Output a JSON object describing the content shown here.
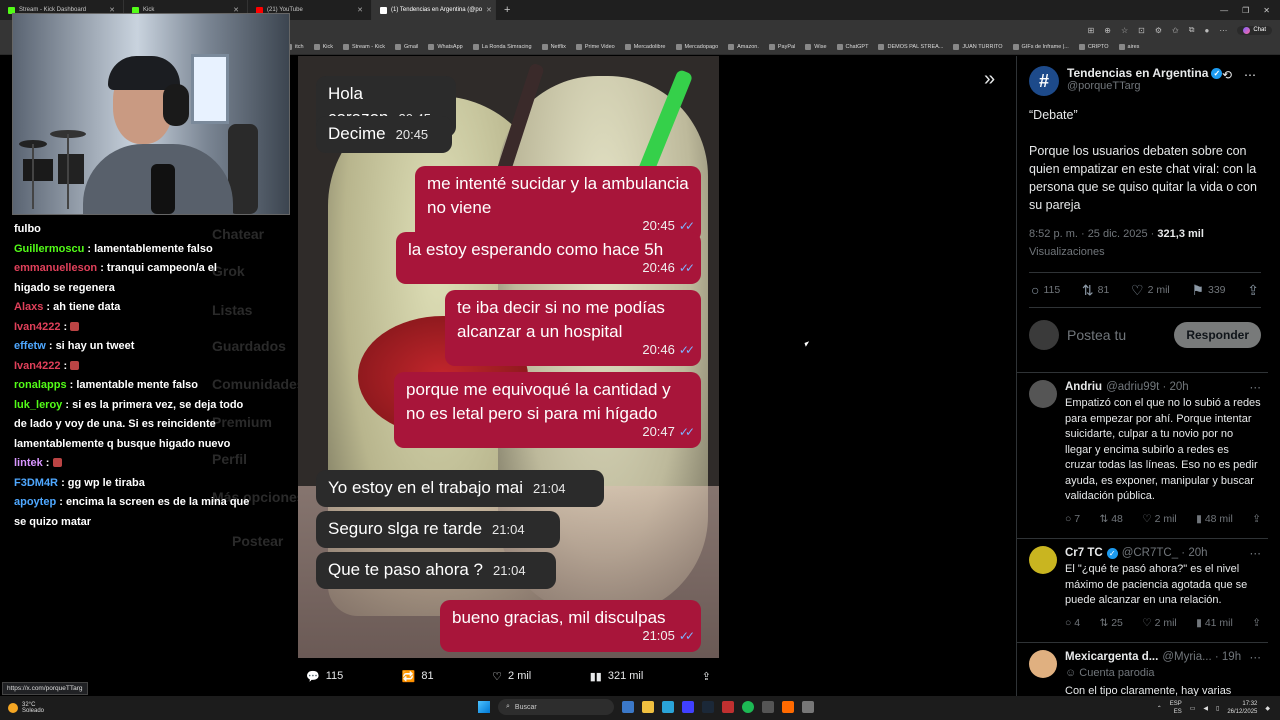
{
  "browser": {
    "tabs": [
      {
        "label": "Stream - Kick Dashboard",
        "active": false,
        "color": "#53fc18"
      },
      {
        "label": "Kick",
        "active": false,
        "color": "#53fc18"
      },
      {
        "label": "(21) YouTube",
        "active": false,
        "color": "#ff0000"
      },
      {
        "label": "(1) Tendencias en Argentina (@po",
        "active": true,
        "color": "#ffffff"
      }
    ],
    "new_tab": "+",
    "chat_label": "Chat",
    "bookmarks": [
      "itch",
      "Kick",
      "Stream - Kick",
      "Gmail",
      "WhatsApp",
      "La Ronda Simracing",
      "Netflix",
      "Prime Video",
      "Mercadolibre",
      "Mercadopago",
      "Amazon.",
      "PayPal",
      "Wise",
      "ChatGPT",
      "DEMOS PAL STREA...",
      "JUAN TURRITO",
      "GIFs de Inframe |...",
      "CRIPTO",
      "aires"
    ]
  },
  "chat": [
    {
      "user": "",
      "text": "fulbo",
      "color": "#ffffff"
    },
    {
      "user": "Guillermoscu",
      "text": "lamentablemente falso",
      "color": "#53fc18"
    },
    {
      "user": "emmanuelleson",
      "text": "tranqui campeon/a el higado se regenera",
      "color": "#e0405a"
    },
    {
      "user": "Alaxs",
      "text": "ah tiene data",
      "color": "#e0405a"
    },
    {
      "user": "Ivan4222",
      "text": "",
      "color": "#e0405a"
    },
    {
      "user": "effetw",
      "text": "si hay un tweet",
      "color": "#4fa8ff"
    },
    {
      "user": "Ivan4222",
      "text": "",
      "color": "#e0405a"
    },
    {
      "user": "ronalapps",
      "text": "lamentable mente falso",
      "color": "#53fc18"
    },
    {
      "user": "luk_leroy",
      "text": "si es la primera vez, se deja todo de lado y voy de una. Si es reincidente lamentablemente q busque higado nuevo",
      "color": "#53fc18"
    },
    {
      "user": "lintek",
      "text": "",
      "color": "#d896ff"
    },
    {
      "user": "F3DM4R",
      "text": "gg wp le tiraba",
      "color": "#4fa8ff"
    },
    {
      "user": "apoytep",
      "text": "encima la screen es de la mina que se quizo matar",
      "color": "#4fa8ff"
    }
  ],
  "ghost_menu": [
    "Chatear",
    "Grok",
    "Listas",
    "Guardados",
    "Comunidades",
    "Premium",
    "Perfil",
    "Más opciones",
    "Postear"
  ],
  "whatsapp": [
    {
      "dir": "in",
      "text": "Hola corazon",
      "time": "20:45"
    },
    {
      "dir": "in",
      "text": "Decime",
      "time": "20:45"
    },
    {
      "dir": "out",
      "text": "me intenté sucidar y la ambulancia no viene",
      "time": "20:45"
    },
    {
      "dir": "out",
      "text": "la estoy esperando como hace 5h",
      "time": "20:46"
    },
    {
      "dir": "out",
      "text": "te iba decir si no me podías alcanzar a un hospital",
      "time": "20:46"
    },
    {
      "dir": "out",
      "text": "porque me equivoqué la cantidad y no es letal pero si para mi hígado",
      "time": "20:47"
    },
    {
      "dir": "in",
      "text": "Yo estoy en el trabajo mai",
      "time": "21:04"
    },
    {
      "dir": "in",
      "text": "Seguro slga re tarde",
      "time": "21:04"
    },
    {
      "dir": "in",
      "text": "Que te paso ahora ?",
      "time": "21:04"
    },
    {
      "dir": "out",
      "text": "bueno gracias, mil disculpas",
      "time": "21:05"
    }
  ],
  "image_actions": {
    "replies": "115",
    "reposts": "81",
    "likes": "2 mil",
    "views": "321 mil"
  },
  "tweet": {
    "author": "Tendencias en Argentina",
    "handle": "@porqueTTarg",
    "text1": "“Debate”",
    "text2": "Porque los usuarios debaten sobre con quien empatizar en este chat viral: con la persona que se quiso quitar la vida o con su pareja",
    "time": "8:52 p. m. · 25 dic. 2025 ·",
    "views_count": "321,3 mil",
    "views_label": "Visualizaciones",
    "replies": "115",
    "reposts": "81",
    "likes": "2 mil",
    "bookmarks": "339",
    "reply_placeholder": "Postea tu",
    "reply_button": "Responder"
  },
  "replies": [
    {
      "name": "Andriu",
      "handle": "@adriu99t · 20h",
      "text": "Empatizó con el que no lo subió a redes para empezar por ahí. Porque intentar suicidarte, culpar a tu novio por no llegar y encima subirlo a redes es cruzar todas las líneas. Eso no es pedir ayuda, es exponer, manipular y buscar validación pública.",
      "replies": "7",
      "reposts": "48",
      "likes": "2 mil",
      "views": "48 mil",
      "color": "#555555"
    },
    {
      "name": "Cr7 TC",
      "handle": "@CR7TC_ · 20h",
      "text": "El \"¿qué te pasó ahora?\" es el nivel máximo de paciencia agotada que se puede alcanzar en una relación.",
      "replies": "4",
      "reposts": "25",
      "likes": "2 mil",
      "views": "41 mil",
      "color": "#c9b520"
    },
    {
      "name": "Mexicargenta d...",
      "handle": "@Myria... · 19h",
      "text": "Cuenta parodia",
      "extra": "Con el tipo claramente, hay varias",
      "color": "#e0b080"
    }
  ],
  "status_url": "https://x.com/porqueTTarg",
  "taskbar": {
    "temp": "32°C",
    "weather": "Soleado",
    "search": "Buscar",
    "lang1": "ESP",
    "lang2": "ES",
    "time": "17:32",
    "date": "26/12/2025"
  }
}
